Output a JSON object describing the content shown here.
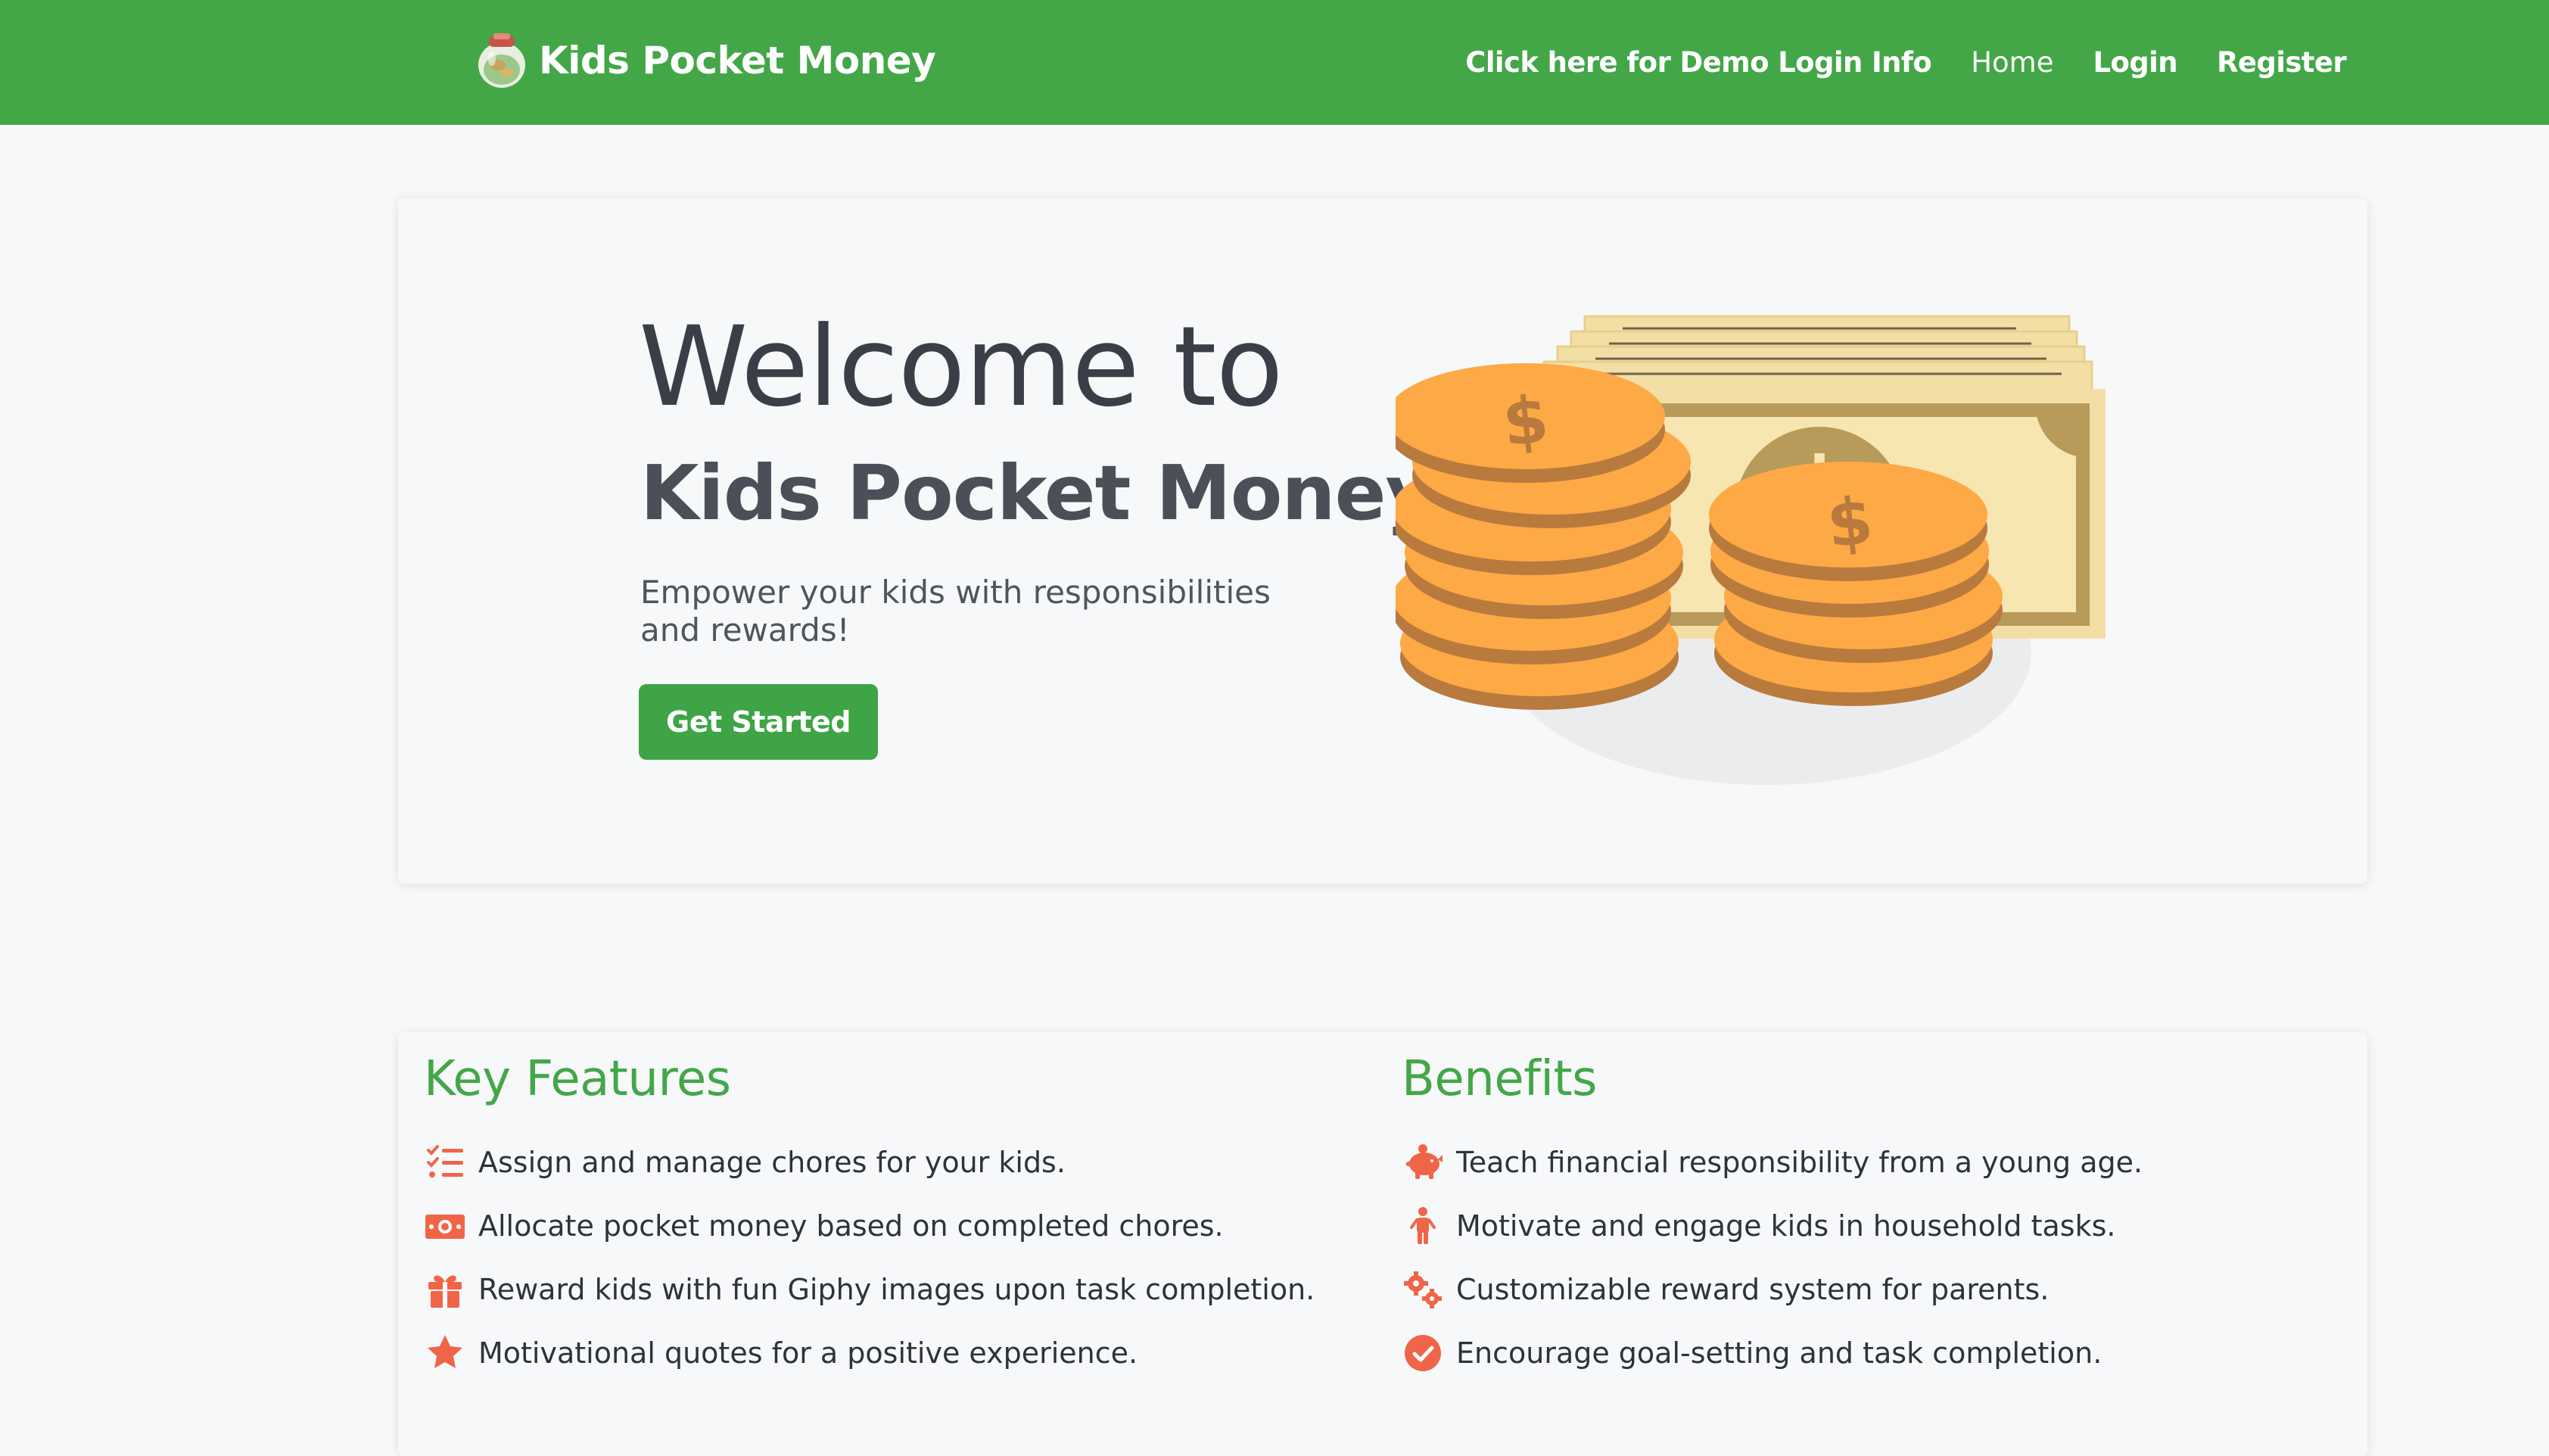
{
  "navbar": {
    "brand": "Kids Pocket Money",
    "links": [
      {
        "label": "Click here for Demo Login Info"
      },
      {
        "label": "Home"
      },
      {
        "label": "Login"
      },
      {
        "label": "Register"
      }
    ]
  },
  "hero": {
    "title": "Welcome to",
    "subtitle": "Kids Pocket Money",
    "lead": "Empower your kids with responsibilities and rewards!",
    "cta": "Get Started"
  },
  "features": {
    "title": "Key Features",
    "items": [
      {
        "icon": "list-check-icon",
        "text": "Assign and manage chores for your kids."
      },
      {
        "icon": "money-bill-icon",
        "text": "Allocate pocket money based on completed chores."
      },
      {
        "icon": "gift-icon",
        "text": "Reward kids with fun Giphy images upon task completion."
      },
      {
        "icon": "star-icon",
        "text": "Motivational quotes for a positive experience."
      }
    ]
  },
  "benefits": {
    "title": "Benefits",
    "items": [
      {
        "icon": "piggy-bank-icon",
        "text": "Teach financial responsibility from a young age."
      },
      {
        "icon": "child-icon",
        "text": "Motivate and engage kids in household tasks."
      },
      {
        "icon": "gears-icon",
        "text": "Customizable reward system for parents."
      },
      {
        "icon": "check-circle-icon",
        "text": "Encourage goal-setting and task completion."
      }
    ]
  },
  "colors": {
    "brand_green": "#43a748",
    "icon_red": "#f06548",
    "coin_orange": "#fda945",
    "bill_cream": "#f3dfa6"
  }
}
